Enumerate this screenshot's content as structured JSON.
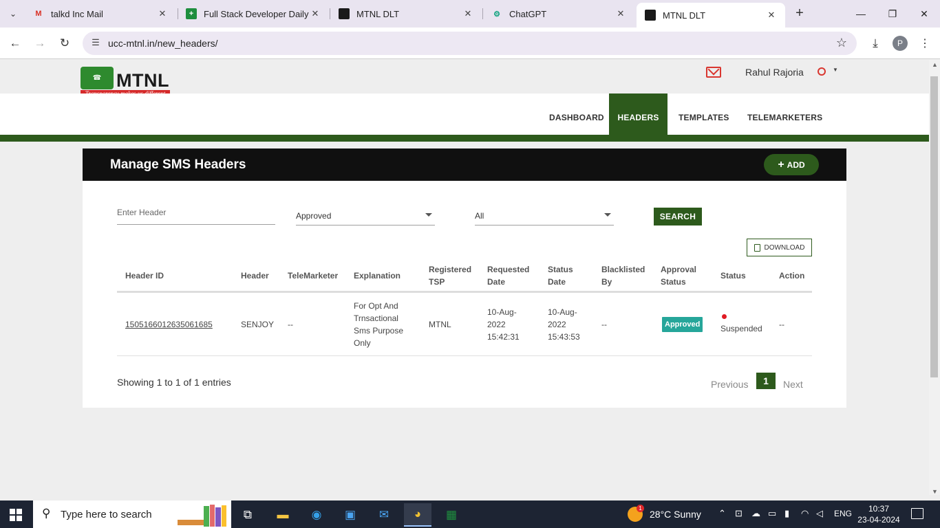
{
  "browser": {
    "tabs": [
      {
        "title": "talkd Inc Mail",
        "icon": "gmail-icon",
        "active": false
      },
      {
        "title": "Full Stack Developer Daily T",
        "icon": "sheets-icon",
        "active": false
      },
      {
        "title": "MTNL DLT",
        "icon": "mtnl-favicon-icon",
        "active": false
      },
      {
        "title": "ChatGPT",
        "icon": "chatgpt-icon",
        "active": false
      },
      {
        "title": "MTNL DLT",
        "icon": "mtnl-favicon-icon",
        "active": true
      }
    ],
    "url": "ucc-mtnl.in/new_headers/",
    "profile_initial": "P"
  },
  "header": {
    "logo_text": "MTNL",
    "logo_tagline": "Transparency makes us different",
    "username": "Rahul Rajoria"
  },
  "nav": {
    "items": [
      "DASHBOARD",
      "HEADERS",
      "TEMPLATES",
      "TELEMARKETERS"
    ],
    "active": "HEADERS"
  },
  "card": {
    "title": "Manage SMS Headers",
    "add_label": "ADD",
    "filters": {
      "header_placeholder": "Enter Header",
      "approval_select": "Approved",
      "status_select": "All",
      "search_label": "SEARCH"
    },
    "download_label": "DOWNLOAD",
    "table": {
      "columns": [
        "Header ID",
        "Header",
        "TeleMarketer",
        "Explanation",
        "Registered TSP",
        "Requested Date",
        "Status Date",
        "Blacklisted By",
        "Approval Status",
        "Status",
        "Action"
      ],
      "rows": [
        {
          "header_id": "1505166012635061685",
          "header": "SENJOY",
          "telemarketer": "--",
          "explanation": "For Opt And Trnsactional Sms Purpose Only",
          "tsp": "MTNL",
          "requested_date": "10-Aug-2022 15:42:31",
          "status_date": "10-Aug-2022 15:43:53",
          "blacklisted_by": "--",
          "approval_status": "Approved",
          "status": "Suspended",
          "action": "--"
        }
      ]
    },
    "info": "Showing 1 to 1 of 1 entries",
    "pager": {
      "previous": "Previous",
      "current": "1",
      "next": "Next"
    }
  },
  "taskbar": {
    "search_placeholder": "Type here to search",
    "weather_badge": "1",
    "weather": "28°C  Sunny",
    "lang": "ENG",
    "time": "10:37",
    "date": "23-04-2024"
  },
  "colors": {
    "brand_green": "#2d5a1c",
    "badge_teal": "#26a69a",
    "status_red": "#e01b24"
  }
}
